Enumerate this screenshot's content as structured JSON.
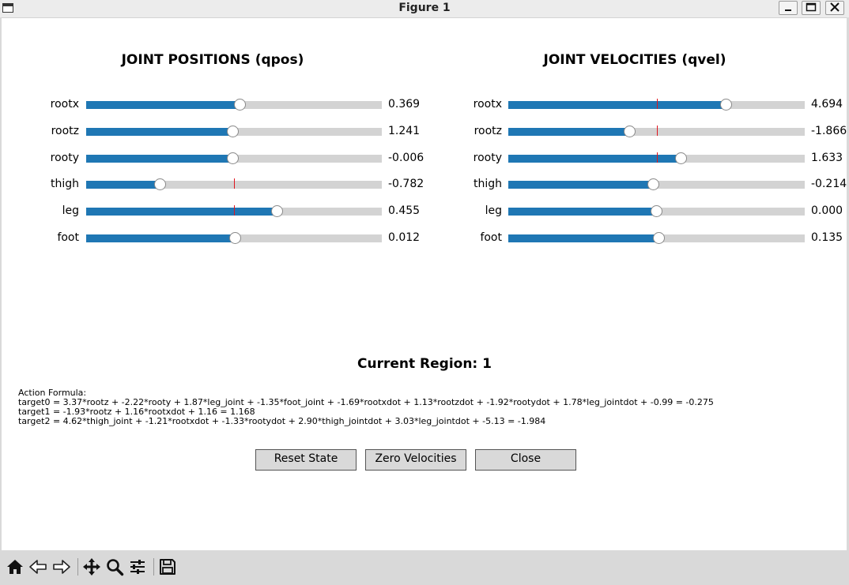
{
  "window": {
    "title": "Figure 1",
    "minimize_glyph": "🗕",
    "maximize_glyph": "🗖",
    "close_glyph": "✕"
  },
  "positions": {
    "title": "JOINT POSITIONS (qpos)",
    "rows": [
      {
        "label": "rootx",
        "value": "0.369",
        "level": 0.52,
        "ref": null
      },
      {
        "label": "rootz",
        "value": "1.241",
        "level": 0.495,
        "ref": null
      },
      {
        "label": "rooty",
        "value": "-0.006",
        "level": 0.495,
        "ref": null
      },
      {
        "label": "thigh",
        "value": "-0.782",
        "level": 0.25,
        "ref": 0.5
      },
      {
        "label": "leg",
        "value": "0.455",
        "level": 0.645,
        "ref": 0.5
      },
      {
        "label": "foot",
        "value": "0.012",
        "level": 0.503,
        "ref": null
      }
    ]
  },
  "velocities": {
    "title": "JOINT VELOCITIES (qvel)",
    "rows": [
      {
        "label": "rootx",
        "value": "4.694",
        "level": 0.735,
        "ref": 0.5
      },
      {
        "label": "rootz",
        "value": "-1.866",
        "level": 0.408,
        "ref": 0.5
      },
      {
        "label": "rooty",
        "value": "1.633",
        "level": 0.582,
        "ref": 0.5
      },
      {
        "label": "thigh",
        "value": "-0.214",
        "level": 0.488,
        "ref": null
      },
      {
        "label": "leg",
        "value": "0.000",
        "level": 0.5,
        "ref": null
      },
      {
        "label": "foot",
        "value": "0.135",
        "level": 0.508,
        "ref": null
      }
    ]
  },
  "region": {
    "text": "Current Region: 1"
  },
  "formula": {
    "header": "Action Formula:",
    "lines": [
      "target0 = 3.37*rootz + -2.22*rooty + 1.87*leg_joint + -1.35*foot_joint + -1.69*rootxdot + 1.13*rootzdot + -1.92*rootydot + 1.78*leg_jointdot + -0.99 = -0.275",
      "target1 = -1.93*rootz + 1.16*rootxdot + 1.16 = 1.168",
      "target2 = 4.62*thigh_joint + -1.21*rootxdot + -1.33*rootydot + 2.90*thigh_jointdot + 3.03*leg_jointdot + -5.13 = -1.984"
    ]
  },
  "buttons": {
    "reset": "Reset State",
    "zero": "Zero Velocities",
    "close": "Close"
  },
  "toolbar": {
    "icons": [
      "home-icon",
      "back-arrow-icon",
      "forward-arrow-icon",
      "pan-icon",
      "zoom-icon",
      "configure-subplots-icon",
      "save-icon"
    ]
  },
  "colors": {
    "slider_fill": "#1f77b4",
    "slider_track": "#d3d3d3",
    "reference_marker": "#e0141e"
  }
}
